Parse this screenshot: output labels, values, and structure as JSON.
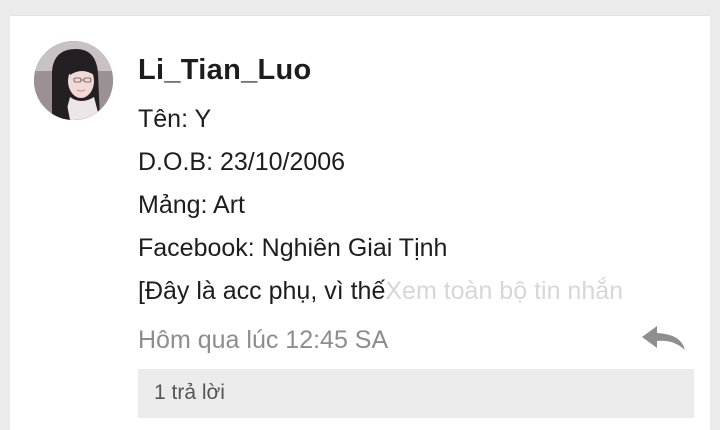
{
  "comment": {
    "author": "Li_Tian_Luo",
    "avatar_icon": "user-avatar",
    "lines": [
      "Tên: Y",
      "D.O.B: 23/10/2006",
      "Mảng: Art",
      "Facebook: Nghiên Giai Tịnh"
    ],
    "truncated_text": "[Đây là acc phụ, vì thế",
    "see_more_label": "Xem toàn bộ tin nhắn",
    "timestamp": "Hôm qua lúc 12:45 SA",
    "reply_icon": "reply-arrow-icon",
    "replies_label": "1 trả lời"
  },
  "colors": {
    "background": "#ebebeb",
    "card": "#ffffff",
    "text": "#1d1d1d",
    "muted": "#8d8d8d",
    "faded": "#d7d7d7",
    "reply_icon": "#8f8f8f"
  }
}
